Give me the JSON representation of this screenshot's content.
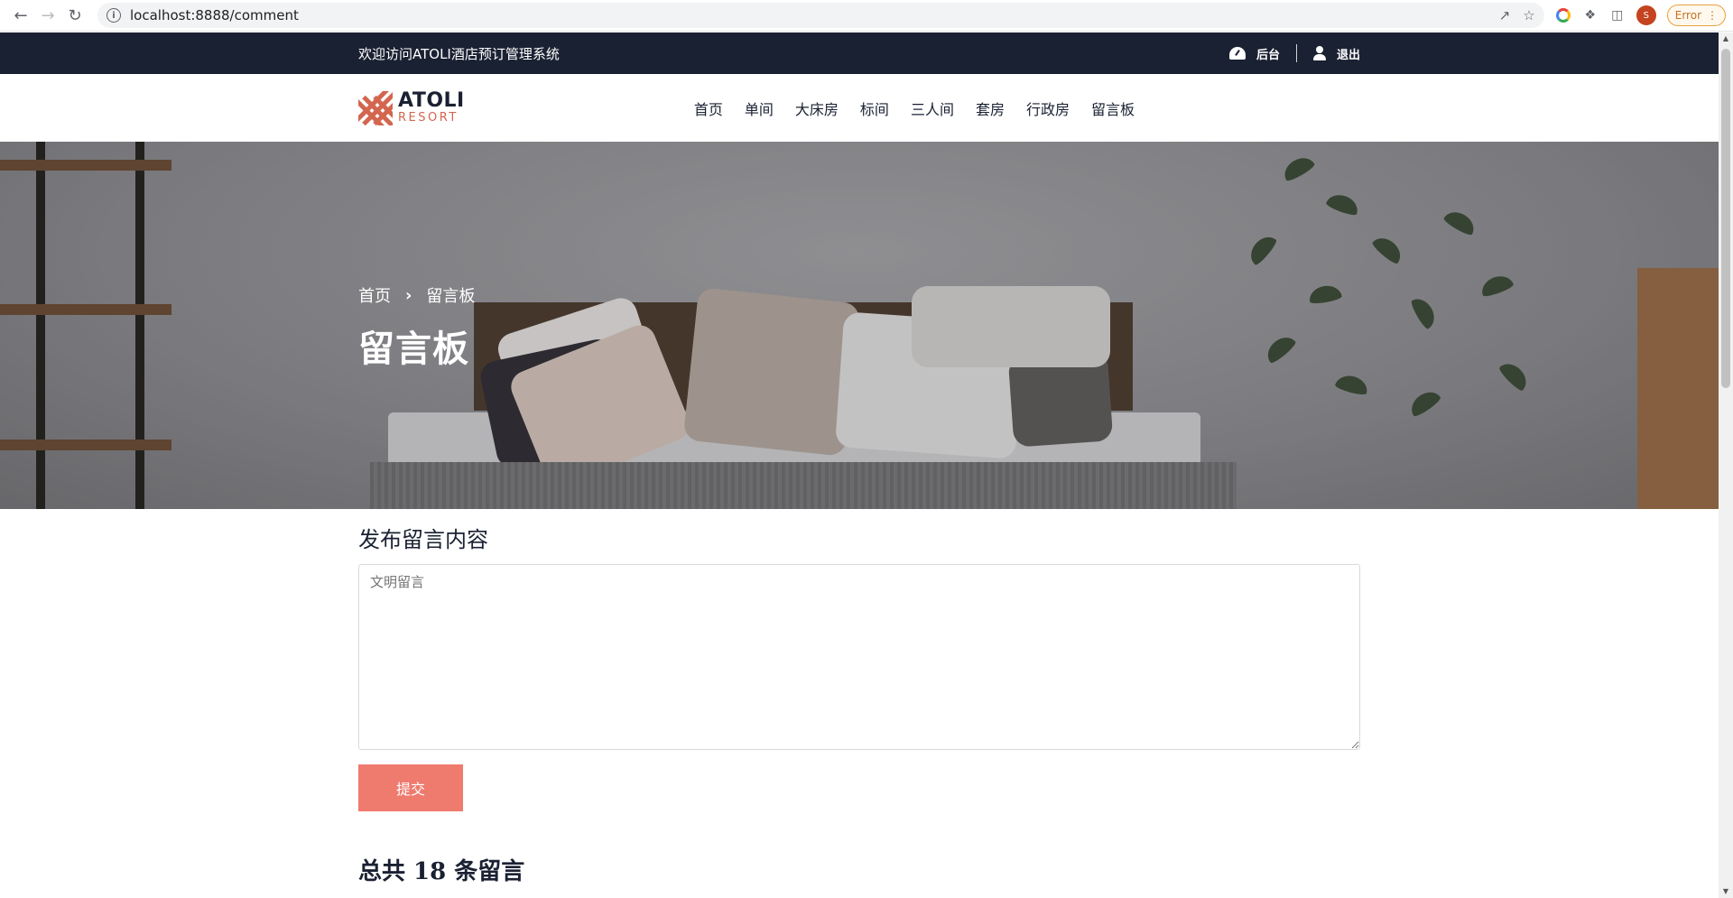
{
  "browser": {
    "url": "localhost:8888/comment",
    "error_label": "Error",
    "profile_initial": "S"
  },
  "topbar": {
    "welcome": "欢迎访问ATOLI酒店预订管理系统",
    "admin_label": "后台",
    "logout_label": "退出"
  },
  "logo": {
    "title": "ATOLI",
    "subtitle": "RESORT"
  },
  "menu": {
    "items": [
      "首页",
      "单间",
      "大床房",
      "标间",
      "三人间",
      "套房",
      "行政房",
      "留言板"
    ]
  },
  "hero": {
    "breadcrumb_home": "首页",
    "breadcrumb_current": "留言板",
    "title": "留言板"
  },
  "form": {
    "title": "发布留言内容",
    "placeholder": "文明留言",
    "submit_label": "提交"
  },
  "comments": {
    "total_label": "总共 18 条留言"
  },
  "colors": {
    "topbar_bg": "#1a2132",
    "accent": "#ef7a6e",
    "logo_accent": "#d3664f"
  }
}
